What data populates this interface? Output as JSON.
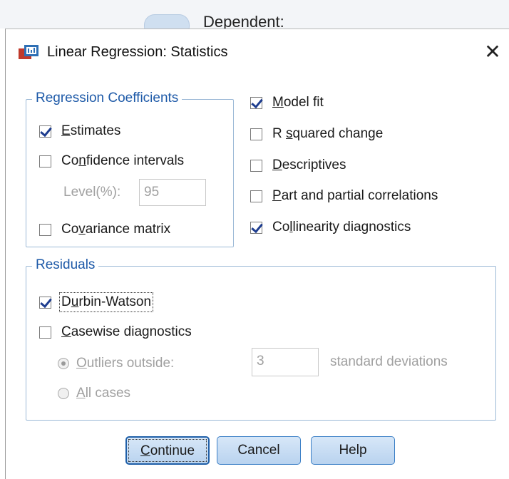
{
  "background": {
    "label": "Dependent:"
  },
  "window": {
    "title": "Linear Regression: Statistics",
    "close_glyph": "✕"
  },
  "regression_coefficients": {
    "legend": "Regression Coefficients",
    "estimates": {
      "pre": "",
      "u": "E",
      "post": "stimates",
      "checked": true
    },
    "confidence_intervals": {
      "pre": "Co",
      "u": "n",
      "post": "fidence intervals",
      "checked": false
    },
    "level_label": "Level(%):",
    "level_value": "95",
    "covariance_matrix": {
      "pre": "Co",
      "u": "v",
      "post": "ariance matrix",
      "checked": false
    }
  },
  "options": {
    "model_fit": {
      "pre": "",
      "u": "M",
      "post": "odel fit",
      "checked": true
    },
    "r_squared_change": {
      "pre": "R ",
      "u": "s",
      "post": "quared change",
      "checked": false
    },
    "descriptives": {
      "pre": "",
      "u": "D",
      "post": "escriptives",
      "checked": false
    },
    "part_partial": {
      "pre": "",
      "u": "P",
      "post": "art and partial correlations",
      "checked": false
    },
    "collinearity": {
      "pre": "Co",
      "u": "l",
      "post": "linearity diagnostics",
      "checked": true
    }
  },
  "residuals": {
    "legend": "Residuals",
    "durbin_watson": {
      "pre": "D",
      "u": "u",
      "post": "rbin-Watson",
      "checked": true
    },
    "casewise": {
      "pre": "",
      "u": "C",
      "post": "asewise diagnostics",
      "checked": false
    },
    "outliers": {
      "pre": "",
      "u": "O",
      "post": "utliers outside:"
    },
    "outliers_value": "3",
    "std_dev_label": "standard deviations",
    "all_cases": {
      "pre": "",
      "u": "A",
      "post": "ll cases"
    }
  },
  "buttons": {
    "continue": {
      "pre": "",
      "u": "C",
      "post": "ontinue"
    },
    "cancel": "Cancel",
    "help": "Help"
  },
  "colors": {
    "legend_text": "#1e5aa8",
    "group_border": "#9cb9d6",
    "button_fill": "#c7ddf4",
    "checkmark": "#1e3d8f"
  }
}
